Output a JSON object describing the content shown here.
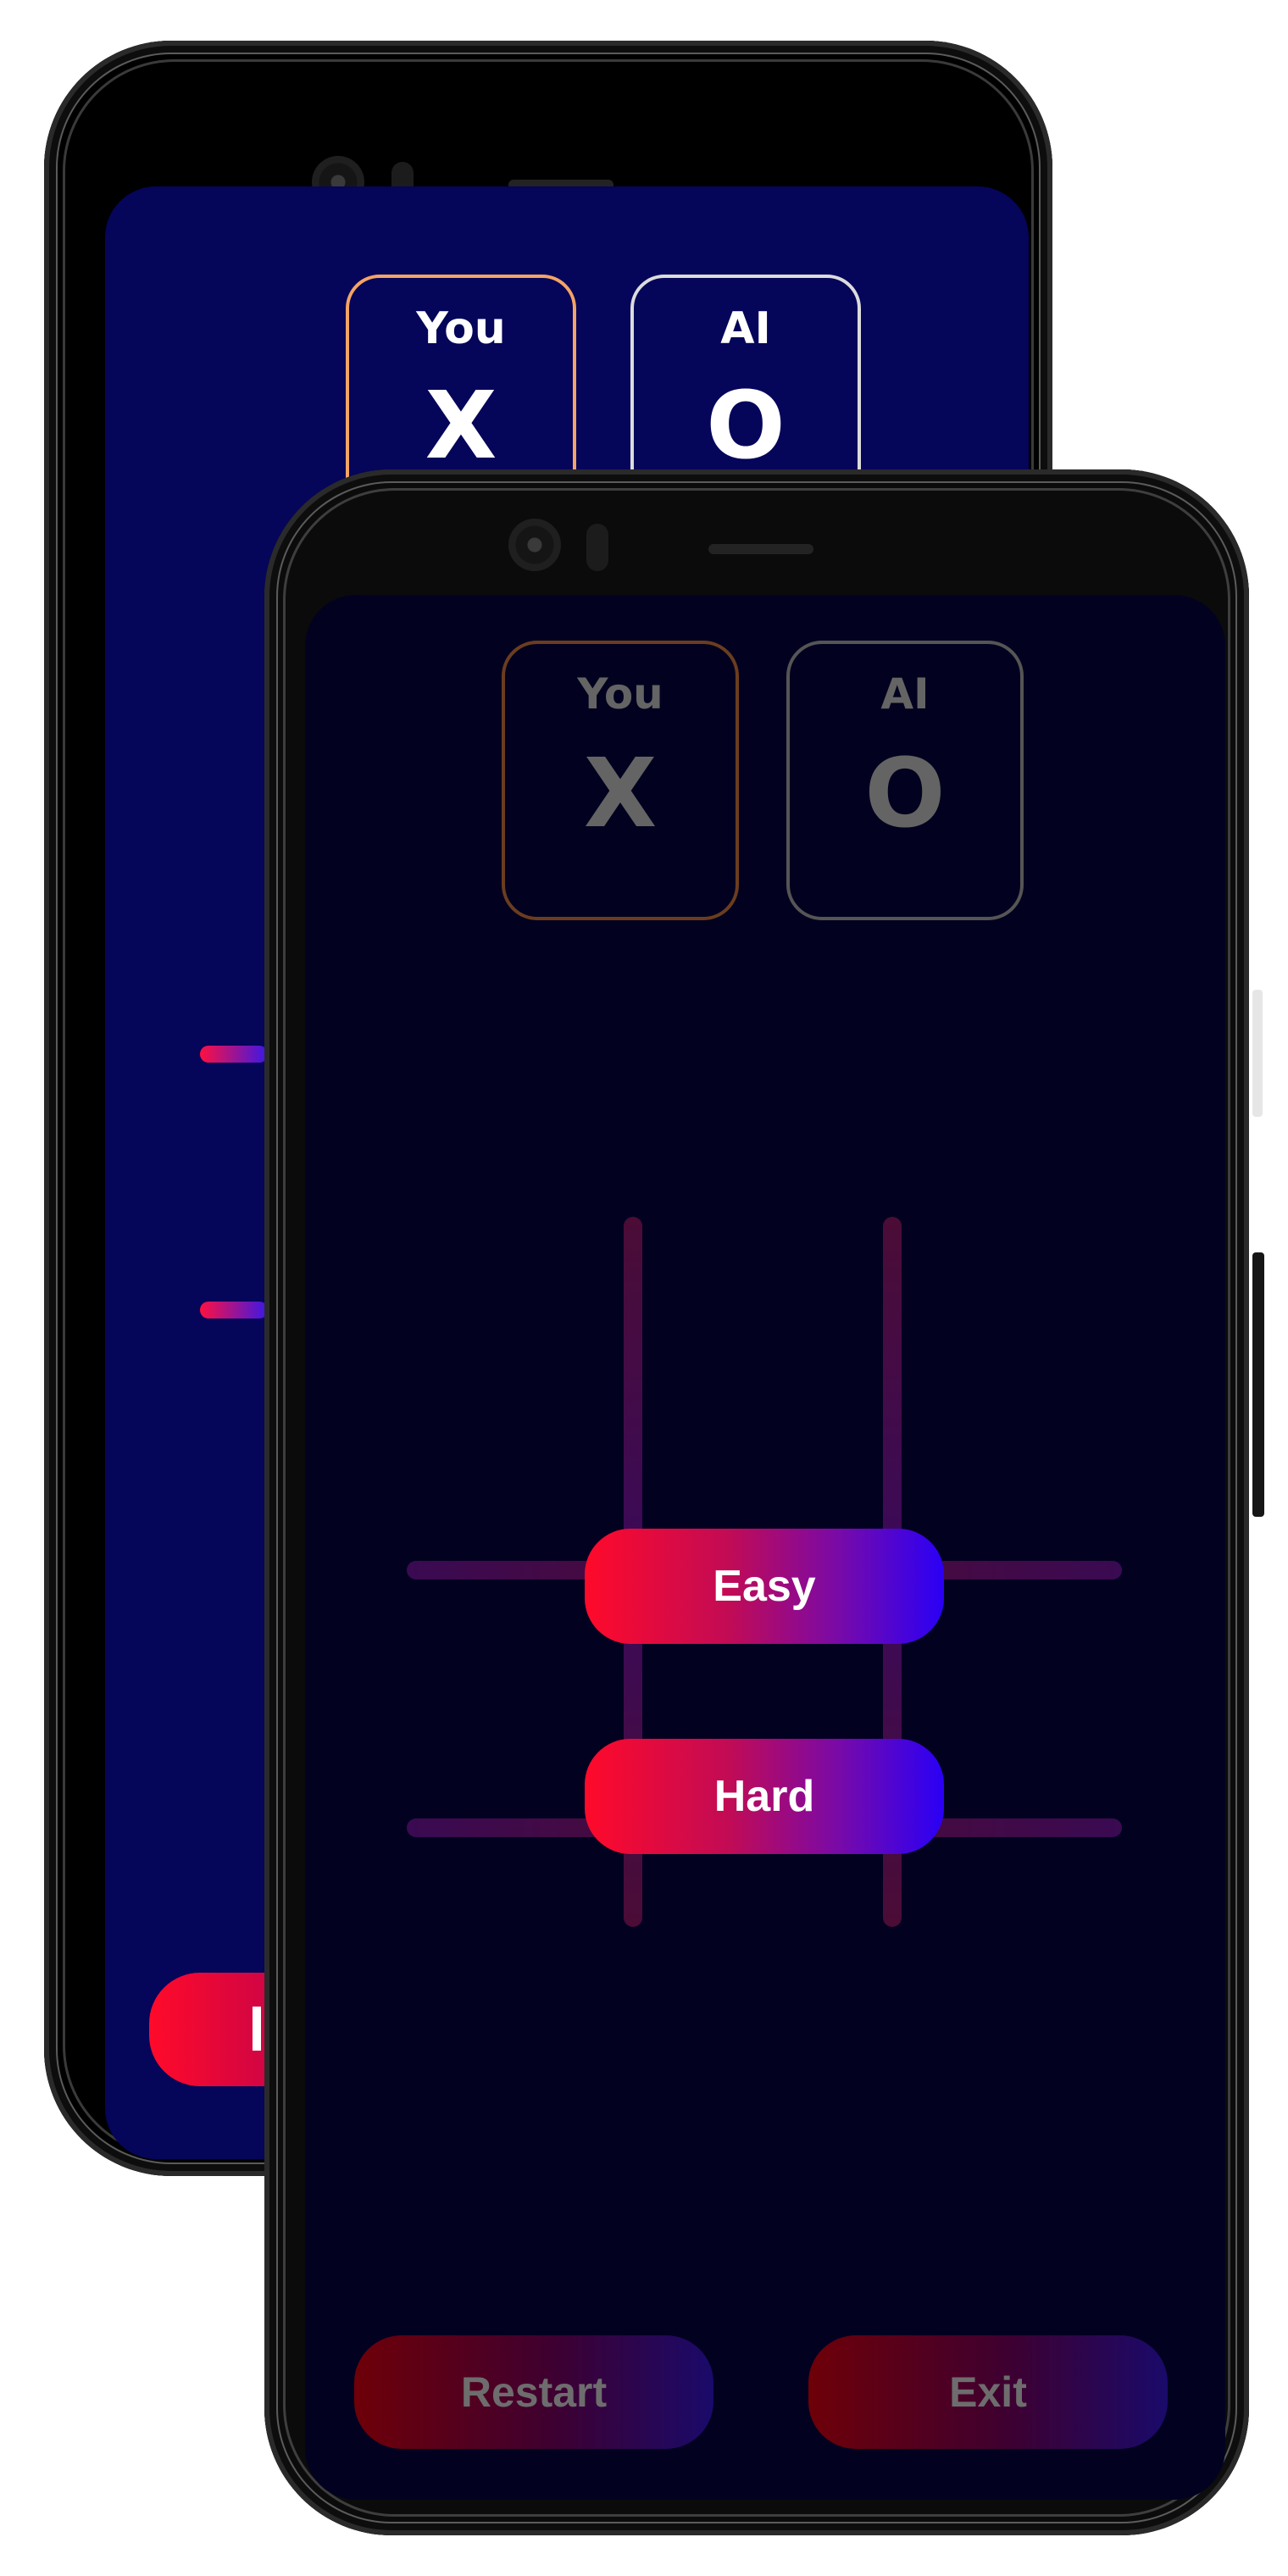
{
  "back_screen": {
    "players": [
      {
        "label": "You",
        "mark": "X"
      },
      {
        "label": "AI",
        "mark": "O"
      }
    ],
    "accent_colors": {
      "you": "#f3a464",
      "ai": "#dcdcdc",
      "background": "#05055a"
    }
  },
  "front_screen": {
    "players": [
      {
        "label": "You",
        "mark": "X"
      },
      {
        "label": "AI",
        "mark": "O"
      }
    ],
    "difficulty_menu": {
      "options": [
        "Easy",
        "Hard"
      ]
    },
    "footer": {
      "restart_label": "Restart",
      "exit_label": "Exit"
    },
    "colors": {
      "background": "#020220",
      "gradient_start": "#ff0a2a",
      "gradient_end": "#2a00f6",
      "dimmed_text": "#646464"
    }
  }
}
